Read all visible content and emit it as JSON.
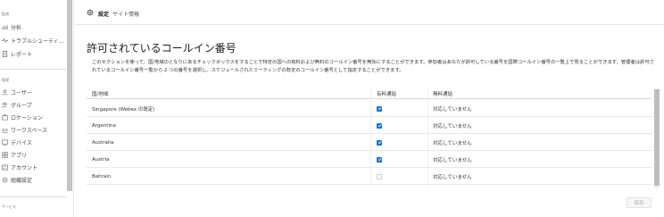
{
  "sidebar": {
    "section_monitor": "監視",
    "monitor_items": [
      {
        "label": "分析",
        "icon": "chart-icon"
      },
      {
        "label": "トラブルシューティ...",
        "icon": "pulse-icon"
      },
      {
        "label": "レポート",
        "icon": "document-icon"
      }
    ],
    "section_manage": "管理",
    "manage_items": [
      {
        "label": "ユーザー",
        "icon": "user-icon"
      },
      {
        "label": "グループ",
        "icon": "group-icon"
      },
      {
        "label": "ロケーション",
        "icon": "location-icon"
      },
      {
        "label": "ワークスペース",
        "icon": "workspace-icon"
      },
      {
        "label": "デバイス",
        "icon": "device-icon"
      },
      {
        "label": "アプリ",
        "icon": "apps-icon"
      },
      {
        "label": "アカウント",
        "icon": "account-icon"
      },
      {
        "label": "組織設定",
        "icon": "settings-icon"
      }
    ],
    "section_service": "サービス"
  },
  "topbar": {
    "title": "設定",
    "subtitle": "サイト情報"
  },
  "main": {
    "title": "許可されているコールイン番号",
    "description": "このセクションを使って、国/地域のとなりにあるチェックボックスをすることで特定の国への有料および無料のコールイン番号を無効にすることができます。参加者はあなたが許可している番号を国際コールイン番号の一覧上で見ることができます。管理者は許可されているコールイン番号一覧から 2 つの番号を選択し、スケジュールされたミーティングの既定のコールイン番号として指定することができます。",
    "columns": [
      "国/地域",
      "有料通話",
      "無料通話"
    ],
    "rows": [
      {
        "country": "Singapore (Webex の既定)",
        "toll": true,
        "tollfree": "対応していません"
      },
      {
        "country": "Argentina",
        "toll": true,
        "tollfree": "対応していません"
      },
      {
        "country": "Australia",
        "toll": true,
        "tollfree": "対応していません"
      },
      {
        "country": "Austria",
        "toll": true,
        "tollfree": "対応していません"
      },
      {
        "country": "Bahrain",
        "toll": false,
        "tollfree": "対応していません"
      }
    ],
    "save_label": "保存"
  },
  "colors": {
    "accent": "#0f6fde",
    "disabled_text": "#a8a8a8"
  }
}
